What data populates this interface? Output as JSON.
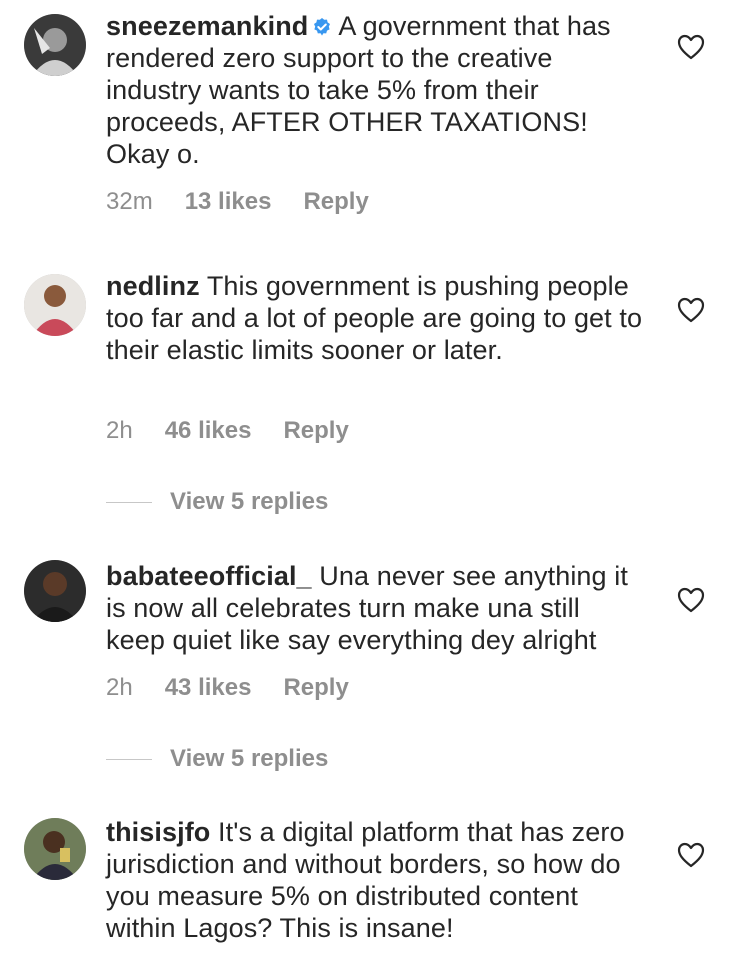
{
  "comments": [
    {
      "username": "sneezemankind",
      "verified": true,
      "text": "A government that has rendered zero support to the creative industry wants to take 5% from their proceeds, AFTER OTHER TAXATIONS! Okay o.",
      "time": "32m",
      "likes": "13 likes",
      "reply": "Reply"
    },
    {
      "username": "nedlinz",
      "verified": false,
      "text": "This government is pushing people too far and a lot of people are going to get to their elastic limits sooner or later.",
      "time": "2h",
      "likes": "46 likes",
      "reply": "Reply",
      "view_replies": "View 5 replies"
    },
    {
      "username": "babateeofficial_",
      "verified": false,
      "text": "Una never see anything it is now all celebrates turn make una still keep quiet like say everything dey alright",
      "time": "2h",
      "likes": "43 likes",
      "reply": "Reply",
      "view_replies": "View 5 replies"
    },
    {
      "username": "thisisjfo",
      "verified": false,
      "text": "It's a digital platform that has zero jurisdiction and without borders, so how do you measure 5% on distributed content within Lagos? This is insane!"
    }
  ],
  "colors": {
    "text": "#262626",
    "muted": "#8e8e8e",
    "verified_badge": "#3897f0"
  },
  "icons": {
    "like": "heart-outline-icon",
    "verified": "verified-badge-icon"
  }
}
